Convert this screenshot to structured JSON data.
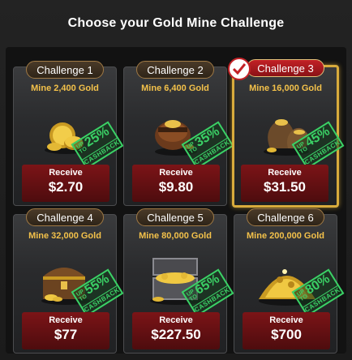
{
  "header": {
    "title": "Choose your Gold Mine Challenge"
  },
  "challenges": [
    {
      "label": "Challenge 1",
      "goal": "Mine 2,400 Gold",
      "cashback_pct": "25%",
      "up_to": "UP TO",
      "cashback": "CASHBACK",
      "receive_label": "Receive",
      "price": "$2.70",
      "selected": false,
      "icon": "gold-coins-icon"
    },
    {
      "label": "Challenge 2",
      "goal": "Mine 6,400 Gold",
      "cashback_pct": "35%",
      "up_to": "UP TO",
      "cashback": "CASHBACK",
      "receive_label": "Receive",
      "price": "$9.80",
      "selected": false,
      "icon": "gold-pouch-icon"
    },
    {
      "label": "Challenge 3",
      "goal": "Mine 16,000 Gold",
      "cashback_pct": "45%",
      "up_to": "UP TO",
      "cashback": "CASHBACK",
      "receive_label": "Receive",
      "price": "$31.50",
      "selected": true,
      "icon": "gold-sacks-icon"
    },
    {
      "label": "Challenge 4",
      "goal": "Mine 32,000 Gold",
      "cashback_pct": "55%",
      "up_to": "UP TO",
      "cashback": "CASHBACK",
      "receive_label": "Receive",
      "price": "$77",
      "selected": false,
      "icon": "treasure-chest-icon"
    },
    {
      "label": "Challenge 5",
      "goal": "Mine 80,000 Gold",
      "cashback_pct": "65%",
      "up_to": "UP TO",
      "cashback": "CASHBACK",
      "receive_label": "Receive",
      "price": "$227.50",
      "selected": false,
      "icon": "open-chest-icon"
    },
    {
      "label": "Challenge 6",
      "goal": "Mine 200,000 Gold",
      "cashback_pct": "80%",
      "up_to": "UP TO",
      "cashback": "CASHBACK",
      "receive_label": "Receive",
      "price": "$700",
      "selected": false,
      "icon": "gold-pile-icon"
    }
  ],
  "colors": {
    "goal": "#f3c14a",
    "stamp": "#3bd166",
    "selected_border": "#d8ab3c",
    "reward": "#7c1417"
  }
}
